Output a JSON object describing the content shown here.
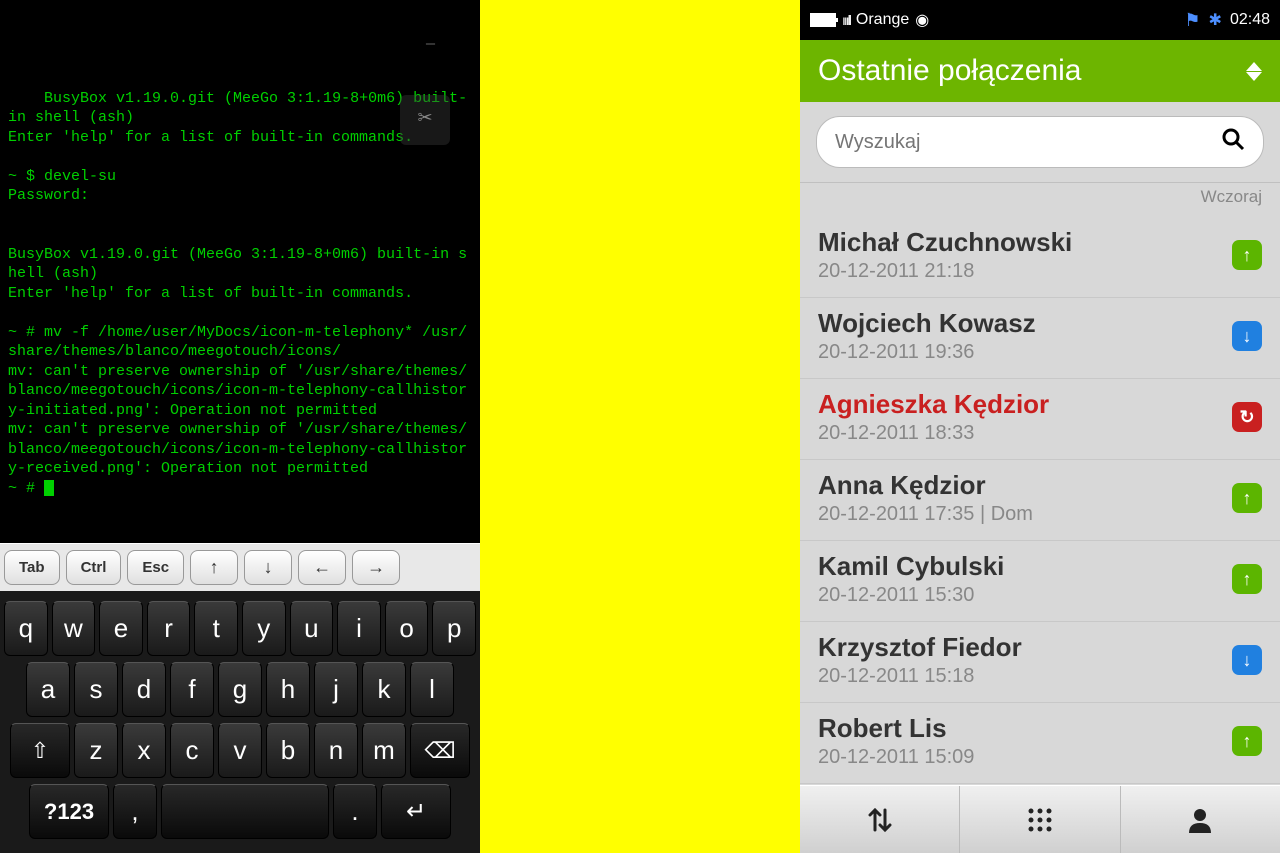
{
  "terminal": {
    "lines": [
      "BusyBox v1.19.0.git (MeeGo 3:1.19-8+0m6) built-in shell (ash)",
      "Enter 'help' for a list of built-in commands.",
      "",
      "~ $ devel-su",
      "Password:",
      "",
      "",
      "BusyBox v1.19.0.git (MeeGo 3:1.19-8+0m6) built-in shell (ash)",
      "Enter 'help' for a list of built-in commands.",
      "",
      "~ # mv -f /home/user/MyDocs/icon-m-telephony* /usr/share/themes/blanco/meegotouch/icons/",
      "mv: can't preserve ownership of '/usr/share/themes/blanco/meegotouch/icons/icon-m-telephony-callhistory-initiated.png': Operation not permitted",
      "mv: can't preserve ownership of '/usr/share/themes/blanco/meegotouch/icons/icon-m-telephony-callhistory-received.png': Operation not permitted",
      "~ # "
    ]
  },
  "toolbar": {
    "tab": "Tab",
    "ctrl": "Ctrl",
    "esc": "Esc"
  },
  "keyboard": {
    "row1": [
      "q",
      "w",
      "e",
      "r",
      "t",
      "y",
      "u",
      "i",
      "o",
      "p"
    ],
    "row2": [
      "a",
      "s",
      "d",
      "f",
      "g",
      "h",
      "j",
      "k",
      "l"
    ],
    "row3": [
      "z",
      "x",
      "c",
      "v",
      "b",
      "n",
      "m"
    ],
    "sym": "?123",
    "comma": ",",
    "dot": "."
  },
  "statusbar": {
    "carrier": "Orange",
    "time": "02:48"
  },
  "phone": {
    "header_title": "Ostatnie połączenia",
    "search_placeholder": "Wyszukaj",
    "section_label": "Wczoraj",
    "calls": [
      {
        "name": "Michał Czuchnowski",
        "time": "20-12-2011 21:18",
        "type": "out"
      },
      {
        "name": "Wojciech Kowasz",
        "time": "20-12-2011 19:36",
        "type": "in"
      },
      {
        "name": "Agnieszka Kędzior",
        "time": "20-12-2011 18:33",
        "type": "missed"
      },
      {
        "name": "Anna Kędzior",
        "time": "20-12-2011 17:35 | Dom",
        "type": "out"
      },
      {
        "name": "Kamil Cybulski",
        "time": "20-12-2011 15:30",
        "type": "out"
      },
      {
        "name": "Krzysztof Fiedor",
        "time": "20-12-2011 15:18",
        "type": "in"
      },
      {
        "name": "Robert Lis",
        "time": "20-12-2011 15:09",
        "type": "out"
      }
    ]
  }
}
